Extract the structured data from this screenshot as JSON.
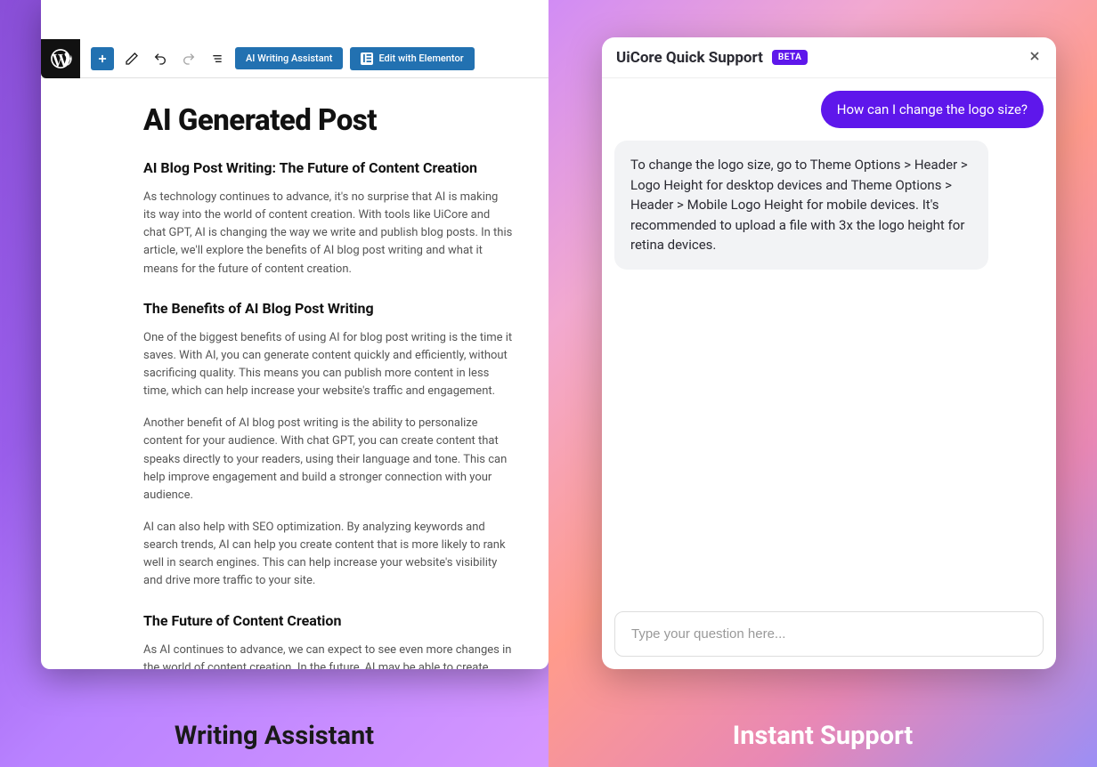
{
  "left": {
    "caption": "Writing Assistant",
    "toolbar": {
      "ai_button": "AI Writing Assistant",
      "elementor_button": "Edit with Elementor"
    },
    "post": {
      "title": "AI Generated Post",
      "h2_1": "AI Blog Post Writing: The Future of Content Creation",
      "p1": "As technology continues to advance, it's no surprise that AI is making its way into the world of content creation. With tools like UiCore and chat GPT, AI is changing the way we write and publish blog posts. In this article, we'll explore the benefits of AI blog post writing and what it means for the future of content creation.",
      "h2_2": "The Benefits of AI Blog Post Writing",
      "p2": "One of the biggest benefits of using AI for blog post writing is the time it saves. With AI, you can generate content quickly and efficiently, without sacrificing quality. This means you can publish more content in less time, which can help increase your website's traffic and engagement.",
      "p3": "Another benefit of AI blog post writing is the ability to personalize content for your audience. With chat GPT, you can create content that speaks directly to your readers, using their language and tone. This can help improve engagement and build a stronger connection with your audience.",
      "p4": "AI can also help with SEO optimization. By analyzing keywords and search trends, AI can help you create content that is more likely to rank well in search engines. This can help increase your website's visibility and drive more traffic to your site.",
      "h2_3": "The Future of Content Creation",
      "p5": "As AI continues to advance, we can expect to see even more changes in the world of content creation. In the future, AI may be able to create entire blog posts from scratch, without any human input. This could revolutionize the way we think about content creation and open up new possibilities for businesses and individuals alike."
    }
  },
  "right": {
    "caption": "Instant Support",
    "header": {
      "title": "UiCore Quick Support",
      "badge": "BETA"
    },
    "chat": {
      "user_msg": "How can I change the logo size?",
      "bot_msg": "To change the logo size, go to Theme Options > Header > Logo Height for desktop devices and Theme Options > Header > Mobile Logo Height for mobile devices. It's recommended to upload a file with 3x the logo height for retina devices.",
      "input_placeholder": "Type your question here..."
    }
  }
}
